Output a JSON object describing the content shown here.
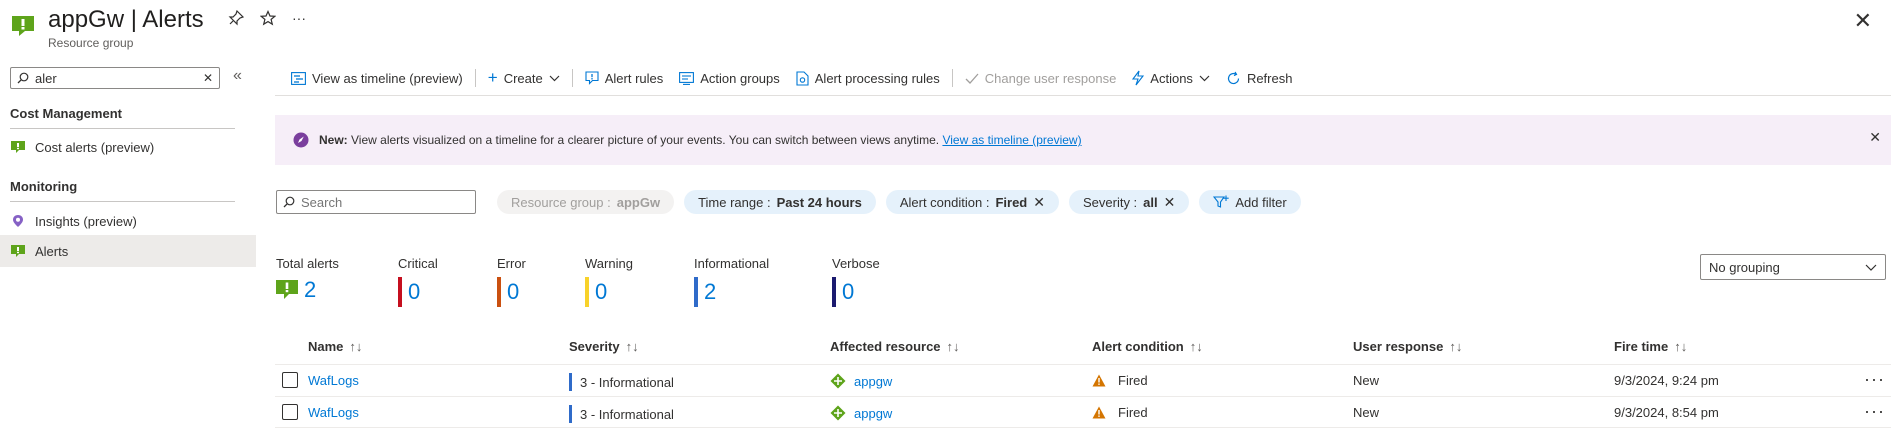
{
  "header": {
    "title": "appGw | Alerts",
    "subtitle": "Resource group",
    "more": "···",
    "close": "✕"
  },
  "sidebar": {
    "search_value": "aler",
    "groups": [
      {
        "label": "Cost Management",
        "items": [
          {
            "label": "Cost alerts (preview)"
          }
        ]
      },
      {
        "label": "Monitoring",
        "items": [
          {
            "label": "Insights (preview)"
          },
          {
            "label": "Alerts",
            "selected": true
          }
        ]
      }
    ]
  },
  "toolbar": {
    "timeline": "View as timeline (preview)",
    "create": "Create",
    "alert_rules": "Alert rules",
    "action_groups": "Action groups",
    "processing_rules": "Alert processing rules",
    "change_response": "Change user response",
    "actions": "Actions",
    "refresh": "Refresh"
  },
  "banner": {
    "new_label": "New:",
    "text": "View alerts visualized on a timeline for a clearer picture of your events. You can switch between views anytime.",
    "link": "View as timeline (preview)"
  },
  "filters": {
    "search_placeholder": "Search",
    "resource_group_label": "Resource group :",
    "resource_group_value": "appGw",
    "time_range_label": "Time range :",
    "time_range_value": "Past 24 hours",
    "condition_label": "Alert condition :",
    "condition_value": "Fired",
    "severity_label": "Severity :",
    "severity_value": "all",
    "add_filter": "Add filter"
  },
  "summary": {
    "total": {
      "label": "Total alerts",
      "value": "2"
    },
    "critical": {
      "label": "Critical",
      "value": "0",
      "color": "#c50f1f"
    },
    "error": {
      "label": "Error",
      "value": "0",
      "color": "#ca5010"
    },
    "warning": {
      "label": "Warning",
      "value": "0",
      "color": "#f8d22a"
    },
    "informational": {
      "label": "Informational",
      "value": "2",
      "color": "#2f6bc9"
    },
    "verbose": {
      "label": "Verbose",
      "value": "0",
      "color": "#1b1a6f"
    }
  },
  "grouping": {
    "value": "No grouping"
  },
  "table": {
    "columns": {
      "name": "Name",
      "severity": "Severity",
      "resource": "Affected resource",
      "condition": "Alert condition",
      "response": "User response",
      "fire_time": "Fire time"
    },
    "sort_glyph": "↑↓",
    "rows": [
      {
        "name": "WafLogs",
        "severity": "3 - Informational",
        "resource": "appgw",
        "condition": "Fired",
        "response": "New",
        "fire_time": "9/3/2024, 9:24 pm"
      },
      {
        "name": "WafLogs",
        "severity": "3 - Informational",
        "resource": "appgw",
        "condition": "Fired",
        "response": "New",
        "fire_time": "9/3/2024, 8:54 pm"
      }
    ]
  }
}
